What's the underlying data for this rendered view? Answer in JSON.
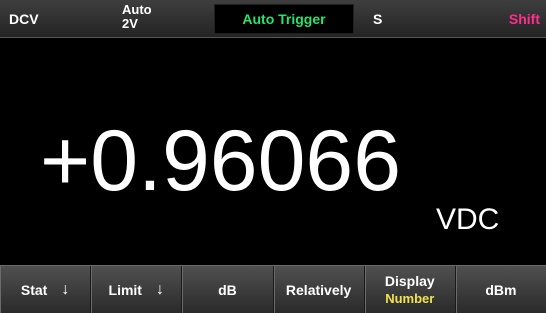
{
  "topbar": {
    "function": "DCV",
    "range_mode": "Auto",
    "range_value": "2V",
    "trigger": "Auto Trigger",
    "rate": "S",
    "shift": "Shift"
  },
  "display": {
    "reading": "+0.96066",
    "unit": "VDC"
  },
  "softkeys": [
    {
      "label": "Stat",
      "icon": "down-arrow-icon",
      "arrow": "↓"
    },
    {
      "label": "Limit",
      "icon": "down-arrow-icon",
      "arrow": "↓"
    },
    {
      "label": "dB"
    },
    {
      "label": "Relatively"
    },
    {
      "label": "Display",
      "sub": "Number"
    },
    {
      "label": "dBm"
    }
  ],
  "colors": {
    "trigger": "#27e36a",
    "shift": "#ff2e8c",
    "highlight": "#f2e34a"
  }
}
